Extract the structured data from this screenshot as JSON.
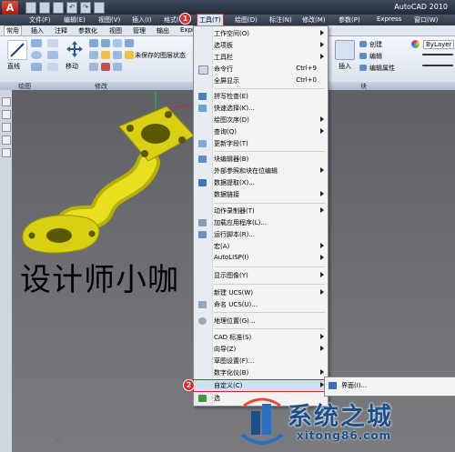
{
  "window": {
    "app_title": "AutoCAD 2010",
    "app_logo": "A"
  },
  "menubar": {
    "items": [
      "文件(F)",
      "编辑(E)",
      "视图(V)",
      "插入(I)",
      "格式(O)",
      "工具(T)",
      "绘图(D)",
      "标注(N)",
      "修改(M)",
      "参数(P)",
      "Express",
      "窗口(W)"
    ]
  },
  "ribbon": {
    "tabs": [
      "常用",
      "插入",
      "注释",
      "参数化",
      "视图",
      "管理",
      "输出",
      "Expr"
    ],
    "labels": {
      "line": "直线",
      "move": "移动",
      "layer_status": "未保存的图层状态",
      "insert": "插入",
      "create": "创建",
      "edit": "编辑",
      "edit_attr": "编辑属性",
      "bylayer": "ByLayer"
    },
    "panels": {
      "draw": "绘图",
      "modify": "修改",
      "block": "块"
    }
  },
  "canvas": {
    "text": "设计师小咖"
  },
  "tools_menu": {
    "items": [
      {
        "label": "工作空间(O)",
        "arrow": true
      },
      {
        "label": "选项板",
        "arrow": true
      },
      {
        "label": "工具栏",
        "arrow": true
      },
      {
        "label": "命令行",
        "shortcut": "Ctrl+9"
      },
      {
        "label": "全屏显示",
        "shortcut": "Ctrl+0"
      },
      {
        "label": "拼写检查(E)"
      },
      {
        "label": "快速选择(K)..."
      },
      {
        "label": "绘图次序(D)",
        "arrow": true
      },
      {
        "label": "查询(Q)",
        "arrow": true
      },
      {
        "label": "更新字段(T)"
      },
      {
        "label": "块编辑器(B)"
      },
      {
        "label": "外部参照和块在位编辑",
        "arrow": true
      },
      {
        "label": "数据提取(X)..."
      },
      {
        "label": "数据链接",
        "arrow": true
      },
      {
        "label": "动作录制器(T)",
        "arrow": true
      },
      {
        "label": "加载应用程序(L)..."
      },
      {
        "label": "运行脚本(R)..."
      },
      {
        "label": "宏(A)",
        "arrow": true
      },
      {
        "label": "AutoLISP(I)",
        "arrow": true
      },
      {
        "label": "显示图像(Y)",
        "arrow": true
      },
      {
        "label": "新建 UCS(W)",
        "arrow": true
      },
      {
        "label": "命名 UCS(U)..."
      },
      {
        "label": "地理位置(G)..."
      },
      {
        "label": "CAD 标准(S)",
        "arrow": true
      },
      {
        "label": "向导(Z)",
        "arrow": true
      },
      {
        "label": "草图设置(F)..."
      },
      {
        "label": "数字化仪(B)",
        "arrow": true
      },
      {
        "label": "自定义(C)",
        "arrow": true
      },
      {
        "label": "选"
      }
    ]
  },
  "submenu": {
    "item": "界面(I)..."
  },
  "badges": {
    "step1": "1",
    "step2": "2"
  },
  "watermark": {
    "title": "系统之城",
    "url": "xitong86.com"
  }
}
